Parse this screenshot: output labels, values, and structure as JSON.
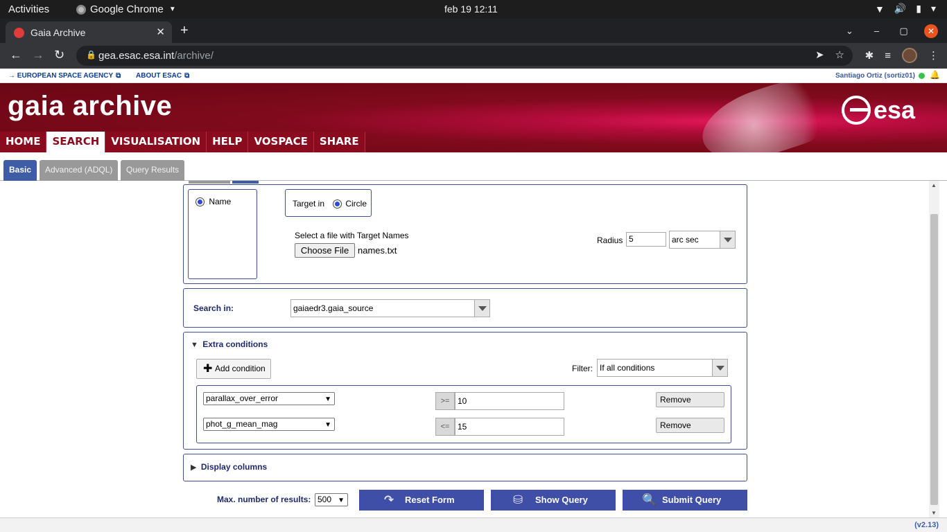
{
  "os": {
    "activities": "Activities",
    "app_name": "Google Chrome",
    "clock": "feb 19  12:11"
  },
  "browser": {
    "tab_title": "Gaia Archive",
    "url_host": "gea.esac.esa.int",
    "url_path": "/archive/"
  },
  "esa_bar": {
    "link1": "EUROPEAN SPACE AGENCY",
    "link2": "ABOUT ESAC",
    "user": "Santiago Ortiz (sortiz01)"
  },
  "banner": {
    "title": "gaia archive",
    "logo_text": "esa"
  },
  "menu": [
    "HOME",
    "SEARCH",
    "VISUALISATION",
    "HELP",
    "VOSPACE",
    "SHARE"
  ],
  "subtabs": [
    "Basic",
    "Advanced (ADQL)",
    "Query Results"
  ],
  "target": {
    "name_label": "Name",
    "target_in_label": "Target in",
    "circle_label": "Circle",
    "file_label": "Select a file with Target Names",
    "choose_file": "Choose File",
    "file_name": "names.txt",
    "radius_label": "Radius",
    "radius_value": "5",
    "radius_unit": "arc sec"
  },
  "search_in": {
    "label": "Search in:",
    "value": "gaiaedr3.gaia_source"
  },
  "extra_conditions": {
    "title": "Extra conditions",
    "add_condition": "Add condition",
    "filter_label": "Filter:",
    "filter_value": "If all conditions",
    "conditions": [
      {
        "column": "parallax_over_error",
        "operator": ">=",
        "value": "10",
        "remove": "Remove"
      },
      {
        "column": "phot_g_mean_mag",
        "operator": "<=",
        "value": "15",
        "remove": "Remove"
      }
    ]
  },
  "display_columns": {
    "title": "Display columns"
  },
  "actions": {
    "max_results_label": "Max. number of results:",
    "max_results_value": "500",
    "reset": "Reset Form",
    "show_query": "Show Query",
    "submit": "Submit Query"
  },
  "footer": {
    "version": "(v2.13)"
  }
}
